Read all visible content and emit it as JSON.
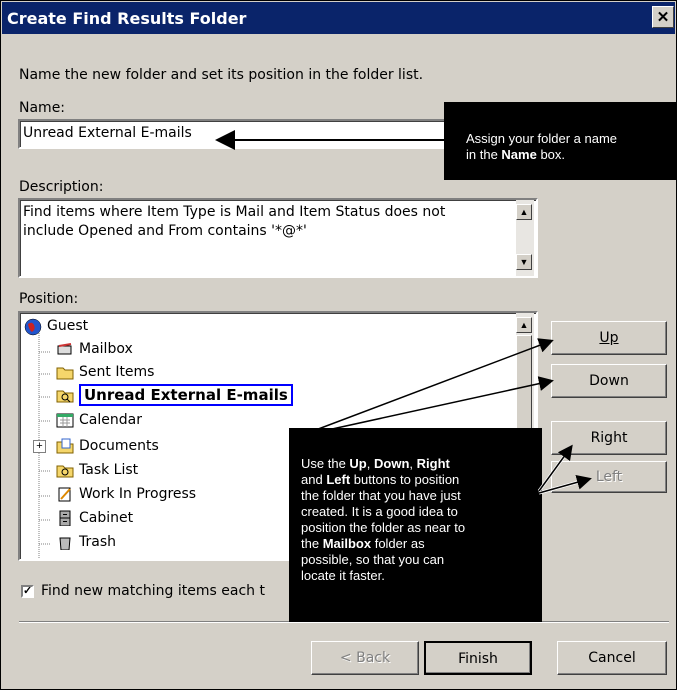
{
  "dialog": {
    "title": "Create Find Results Folder",
    "close_glyph": "✕",
    "instruction": "Name the new folder and set its position in the folder list."
  },
  "name_field": {
    "label": "Name:",
    "value": "Unread External E-mails"
  },
  "description_field": {
    "label": "Description:",
    "line1": "Find items where Item Type is Mail and Item Status does not",
    "line2": "include Opened and From  contains '*@*'"
  },
  "position": {
    "label": "Position:",
    "tree": [
      {
        "label": "Guest",
        "icon": "globe-icon"
      },
      {
        "label": "Mailbox",
        "icon": "mailbox-icon"
      },
      {
        "label": "Sent Items",
        "icon": "folder-icon"
      },
      {
        "label": "Unread External E-mails",
        "icon": "find-folder-icon",
        "selected": true
      },
      {
        "label": "Calendar",
        "icon": "calendar-icon"
      },
      {
        "label": "Documents",
        "icon": "documents-icon",
        "expander": "+"
      },
      {
        "label": "Task List",
        "icon": "task-list-icon"
      },
      {
        "label": "Work In Progress",
        "icon": "work-in-progress-icon"
      },
      {
        "label": "Cabinet",
        "icon": "cabinet-icon"
      },
      {
        "label": "Trash",
        "icon": "trash-icon"
      }
    ],
    "buttons": {
      "up": "Up",
      "down": "Down",
      "right": "Right",
      "left": "Left"
    }
  },
  "checkbox": {
    "label": "Find new matching items each t",
    "checked": true,
    "mark": "✓"
  },
  "footer": {
    "back": "< Back",
    "finish": "Finish",
    "cancel": "Cancel"
  },
  "callouts": {
    "name": {
      "line1": "Assign your folder a name",
      "pre": "in the ",
      "bold": "Name",
      "post": " box."
    },
    "position": {
      "l1_pre": "Use the ",
      "up": "Up",
      "c1": ", ",
      "down": "Down",
      "c2": ", ",
      "right": "Right",
      "l2_pre": "and ",
      "left": "Left",
      "l2_post": " buttons to position",
      "l3": "the folder that you have just",
      "l4": "created.  It is a good idea to",
      "l5": "position the folder as near to",
      "l6_pre": "the ",
      "mailbox": "Mailbox",
      "l6_post": " folder as",
      "l7": "possible, so that you can",
      "l8": "locate it faster."
    }
  },
  "colors": {
    "titlebar": "#0a246a",
    "dialog_bg": "#d4d0c8",
    "selection_border": "#0000ff",
    "callout_bg": "#000000"
  }
}
